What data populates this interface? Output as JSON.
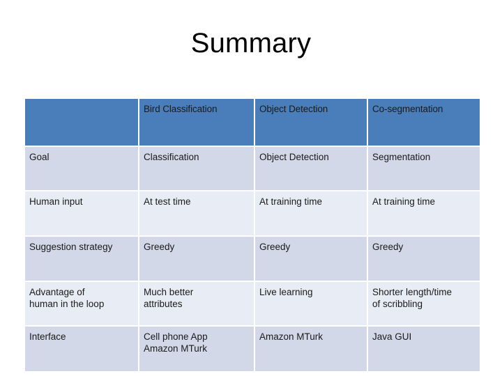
{
  "slide": {
    "title": "Summary"
  },
  "colors": {
    "header_blue": "#4A7EBB",
    "band_dark": "#D2D8E7",
    "band_light": "#E8ECF4",
    "header_text": "#FFFFFF",
    "body_text": "#1A1A1A",
    "background": "#FFFFFF"
  },
  "table": {
    "headers": [
      "",
      "Bird Classification",
      "Object Detection",
      "Co-segmentation"
    ],
    "rows": [
      {
        "label": "Goal",
        "cells": [
          "Classification",
          "Object Detection",
          "Segmentation"
        ]
      },
      {
        "label": "Human input",
        "cells": [
          "At test time",
          "At training time",
          "At training time"
        ]
      },
      {
        "label": "Suggestion strategy",
        "cells": [
          "Greedy",
          "Greedy",
          "Greedy"
        ]
      },
      {
        "label": "Advantage of human in the loop",
        "label_lines": [
          "Advantage of",
          "human in the loop"
        ],
        "cells": [
          "Much better attributes",
          "Live learning",
          "Shorter length/time of scribbling"
        ],
        "cell_lines": [
          [
            "Much better",
            "attributes"
          ],
          [
            "Live learning"
          ],
          [
            "Shorter length/time",
            "of scribbling"
          ]
        ]
      },
      {
        "label": "Interface",
        "cells": [
          "Cell phone App Amazon MTurk",
          "Amazon MTurk",
          "Java GUI"
        ],
        "cell_lines": [
          [
            "Cell phone App",
            "Amazon MTurk"
          ],
          [
            "Amazon MTurk"
          ],
          [
            "Java GUI"
          ]
        ]
      }
    ]
  }
}
